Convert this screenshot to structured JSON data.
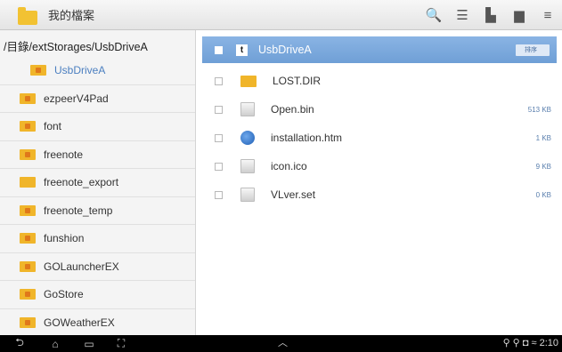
{
  "app": {
    "title": "我的檔案",
    "icon": "folder-icon"
  },
  "toolbar": {
    "buttons": [
      {
        "name": "search-icon",
        "glyph": "🔍"
      },
      {
        "name": "list-view-icon",
        "glyph": "☰"
      },
      {
        "name": "upload-icon",
        "glyph": "▙"
      },
      {
        "name": "folder-icon",
        "glyph": "▆"
      },
      {
        "name": "menu-icon",
        "glyph": "≡"
      }
    ]
  },
  "sidebar": {
    "path": "/目錄/extStorages/UsbDriveA",
    "current": "UsbDriveA",
    "folders": [
      "ezpeerV4Pad",
      "font",
      "freenote",
      "freenote_export",
      "freenote_temp",
      "funshion",
      "GOLauncherEX",
      "GoStore",
      "GOWeatherEX"
    ]
  },
  "main": {
    "header": {
      "badge": "t",
      "title": "UsbDriveA",
      "sort_label": "排序"
    },
    "files": [
      {
        "name": "LOST.DIR",
        "type": "folder",
        "size": ""
      },
      {
        "name": "Open.bin",
        "type": "file",
        "size": "513 KB"
      },
      {
        "name": "installation.htm",
        "type": "globe",
        "size": "1 KB"
      },
      {
        "name": "icon.ico",
        "type": "file",
        "size": "9 KB"
      },
      {
        "name": "VLver.set",
        "type": "file",
        "size": "0 KB"
      }
    ]
  },
  "navbar": {
    "back": "⮌",
    "home": "⌂",
    "recent": "▭",
    "screenshot": "⛶",
    "up": "︿",
    "status": "⚲ ⚲ ◘ ≈ 2:10"
  },
  "colors": {
    "accent": "#6f9fd6",
    "folder": "#f0b52a",
    "selected_text": "#4b7fc0"
  }
}
